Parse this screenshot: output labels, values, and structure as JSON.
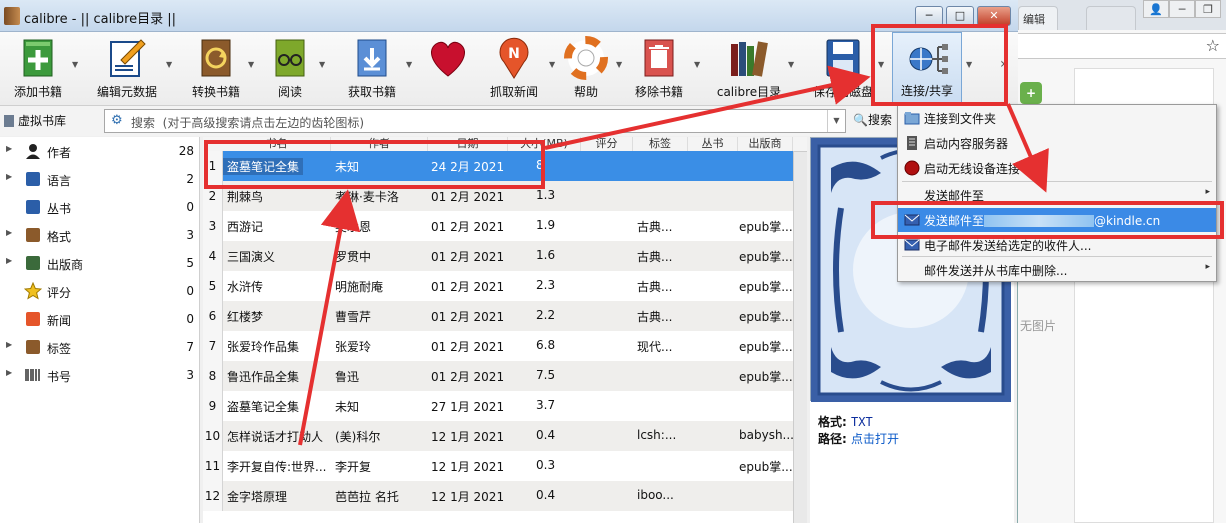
{
  "window": {
    "title": "calibre - || calibre目录 ||",
    "minimize": "─",
    "maximize": "□",
    "close": "✕"
  },
  "toolbar": {
    "items": [
      {
        "label": "添加书籍",
        "icon": "add-book-icon"
      },
      {
        "label": "编辑元数据",
        "icon": "edit-metadata-icon"
      },
      {
        "label": "转换书籍",
        "icon": "convert-book-icon"
      },
      {
        "label": "阅读",
        "icon": "read-icon"
      },
      {
        "label": "获取书籍",
        "icon": "get-books-icon"
      },
      {
        "label": "",
        "icon": "donate-heart-icon"
      },
      {
        "label": "抓取新闻",
        "icon": "fetch-news-icon"
      },
      {
        "label": "帮助",
        "icon": "help-icon"
      },
      {
        "label": "移除书籍",
        "icon": "remove-books-icon"
      },
      {
        "label": "calibre目录",
        "icon": "calibre-library-icon"
      },
      {
        "label": "保存到磁盘",
        "icon": "save-to-disk-icon"
      },
      {
        "label": "连接/共享",
        "icon": "connect-share-icon"
      }
    ],
    "more": "›"
  },
  "search": {
    "virtual_library": "虚拟书库",
    "placeholder_prefix": "搜索",
    "placeholder": "(对于高级搜索请点击左边的齿轮图标)",
    "button": "搜索"
  },
  "sidebar": {
    "items": [
      {
        "label": "作者",
        "count": "28",
        "icon": "author-icon",
        "expandable": true
      },
      {
        "label": "语言",
        "count": "2",
        "icon": "language-icon",
        "expandable": true
      },
      {
        "label": "丛书",
        "count": "0",
        "icon": "series-icon",
        "expandable": false
      },
      {
        "label": "格式",
        "count": "3",
        "icon": "format-icon",
        "expandable": true
      },
      {
        "label": "出版商",
        "count": "5",
        "icon": "publisher-icon",
        "expandable": true
      },
      {
        "label": "评分",
        "count": "0",
        "icon": "rating-star-icon",
        "expandable": false
      },
      {
        "label": "新闻",
        "count": "0",
        "icon": "news-icon",
        "expandable": false
      },
      {
        "label": "标签",
        "count": "7",
        "icon": "tag-icon",
        "expandable": true
      },
      {
        "label": "书号",
        "count": "3",
        "icon": "barcode-icon",
        "expandable": true
      }
    ]
  },
  "table": {
    "columns": [
      "书名",
      "作者",
      "日期",
      "大小(MB)",
      "评分",
      "标签",
      "丛书",
      "出版商"
    ],
    "rows": [
      {
        "num": "1",
        "title": "盗墓笔记全集",
        "author": "未知",
        "date": "24 2月 2021",
        "size": "8",
        "tags": "",
        "publisher": ""
      },
      {
        "num": "2",
        "title": "荆棘鸟",
        "author": "考琳·麦卡洛",
        "date": "01 2月 2021",
        "size": "1.3",
        "tags": "",
        "publisher": ""
      },
      {
        "num": "3",
        "title": "西游记",
        "author": "吴承恩",
        "date": "01 2月 2021",
        "size": "1.9",
        "tags": "古典...",
        "publisher": "epub掌..."
      },
      {
        "num": "4",
        "title": "三国演义",
        "author": "罗贯中",
        "date": "01 2月 2021",
        "size": "1.6",
        "tags": "古典...",
        "publisher": "epub掌..."
      },
      {
        "num": "5",
        "title": "水浒传",
        "author": "明施耐庵",
        "date": "01 2月 2021",
        "size": "2.3",
        "tags": "古典...",
        "publisher": "epub掌..."
      },
      {
        "num": "6",
        "title": "红楼梦",
        "author": "曹雪芹",
        "date": "01 2月 2021",
        "size": "2.2",
        "tags": "古典...",
        "publisher": "epub掌..."
      },
      {
        "num": "7",
        "title": "张爱玲作品集",
        "author": "张爱玲",
        "date": "01 2月 2021",
        "size": "6.8",
        "tags": "现代...",
        "publisher": "epub掌..."
      },
      {
        "num": "8",
        "title": "鲁迅作品全集",
        "author": "鲁迅",
        "date": "01 2月 2021",
        "size": "7.5",
        "tags": "",
        "publisher": "epub掌..."
      },
      {
        "num": "9",
        "title": "盗墓笔记全集",
        "author": "未知",
        "date": "27 1月 2021",
        "size": "3.7",
        "tags": "",
        "publisher": ""
      },
      {
        "num": "10",
        "title": "怎样说话才打动人",
        "author": "(美)科尔",
        "date": "12 1月 2021",
        "size": "0.4",
        "tags": "lcsh:...",
        "publisher": "babysh..."
      },
      {
        "num": "11",
        "title": "李开复自传:世界...",
        "author": "李开复",
        "date": "12 1月 2021",
        "size": "0.3",
        "tags": "",
        "publisher": "epub掌..."
      },
      {
        "num": "12",
        "title": "金字塔原理",
        "author": "芭芭拉 名托",
        "date": "12 1月 2021",
        "size": "0.4",
        "tags": "iboo...",
        "publisher": ""
      }
    ]
  },
  "details": {
    "format_label": "格式:",
    "format_value": "TXT",
    "path_label": "路径:",
    "path_value": "点击打开"
  },
  "menu": {
    "items": [
      {
        "label": "连接到文件夹",
        "icon": "folder-icon",
        "arrow": false
      },
      {
        "label": "启动内容服务器",
        "icon": "server-icon",
        "arrow": false
      },
      {
        "label": "启动无线设备连接",
        "icon": "wireless-icon",
        "arrow": false
      },
      {
        "label": "发送邮件至",
        "icon": "",
        "arrow": true
      },
      {
        "label": "发送邮件至",
        "suffix": "@kindle.cn",
        "icon": "email-icon",
        "arrow": false,
        "highlighted": true
      },
      {
        "label": "电子邮件发送给选定的收件人...",
        "icon": "email-icon",
        "arrow": false
      },
      {
        "label": "邮件发送并从书库中删除...",
        "icon": "",
        "arrow": true
      }
    ],
    "arrow_glyph": "▸"
  },
  "background": {
    "tab_text": "编辑",
    "no_image": "无图片",
    "star": "☆"
  },
  "colors": {
    "annotation_red": "#e53030",
    "selection_blue": "#3a8ee6",
    "menu_highlight": "#3b8ae6"
  }
}
